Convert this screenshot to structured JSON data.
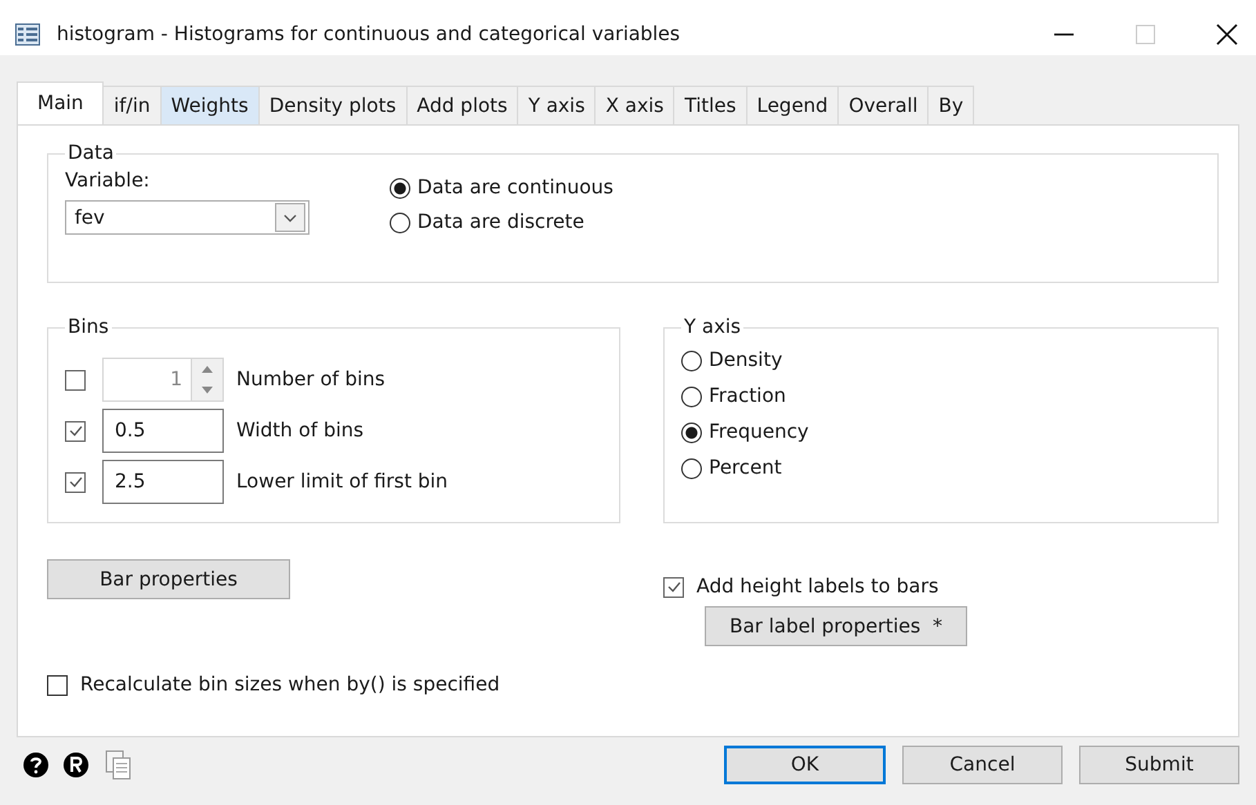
{
  "window": {
    "title": "histogram - Histograms for continuous and categorical variables"
  },
  "tabs": [
    {
      "label": "Main",
      "selected": true,
      "hovered": false
    },
    {
      "label": "if/in",
      "selected": false,
      "hovered": false
    },
    {
      "label": "Weights",
      "selected": false,
      "hovered": true
    },
    {
      "label": "Density plots",
      "selected": false,
      "hovered": false
    },
    {
      "label": "Add plots",
      "selected": false,
      "hovered": false
    },
    {
      "label": "Y axis",
      "selected": false,
      "hovered": false
    },
    {
      "label": "X axis",
      "selected": false,
      "hovered": false
    },
    {
      "label": "Titles",
      "selected": false,
      "hovered": false
    },
    {
      "label": "Legend",
      "selected": false,
      "hovered": false
    },
    {
      "label": "Overall",
      "selected": false,
      "hovered": false
    },
    {
      "label": "By",
      "selected": false,
      "hovered": false
    }
  ],
  "data_group": {
    "title": "Data",
    "variable_label": "Variable:",
    "variable_value": "fev",
    "options": [
      {
        "label": "Data are continuous",
        "selected": true
      },
      {
        "label": "Data are discrete",
        "selected": false
      }
    ]
  },
  "bins_group": {
    "title": "Bins",
    "rows": [
      {
        "kind": "spinner",
        "checked": false,
        "value": "1",
        "label": "Number of bins"
      },
      {
        "kind": "text",
        "checked": true,
        "value": "0.5",
        "label": "Width of bins"
      },
      {
        "kind": "text",
        "checked": true,
        "value": "2.5",
        "label": "Lower limit of first bin"
      }
    ]
  },
  "yaxis_group": {
    "title": "Y axis",
    "options": [
      {
        "label": "Density",
        "selected": false
      },
      {
        "label": "Fraction",
        "selected": false
      },
      {
        "label": "Frequency",
        "selected": true
      },
      {
        "label": "Percent",
        "selected": false
      }
    ]
  },
  "bar_properties_button": "Bar properties",
  "height_labels": {
    "label": "Add height labels to bars",
    "checked": true
  },
  "bar_label_properties_button": "Bar label properties  *",
  "recalculate": {
    "label": "Recalculate bin sizes when by() is specified",
    "checked": false
  },
  "footer": {
    "buttons": [
      {
        "label": "OK",
        "default": true
      },
      {
        "label": "Cancel",
        "default": false
      },
      {
        "label": "Submit",
        "default": false
      }
    ]
  }
}
